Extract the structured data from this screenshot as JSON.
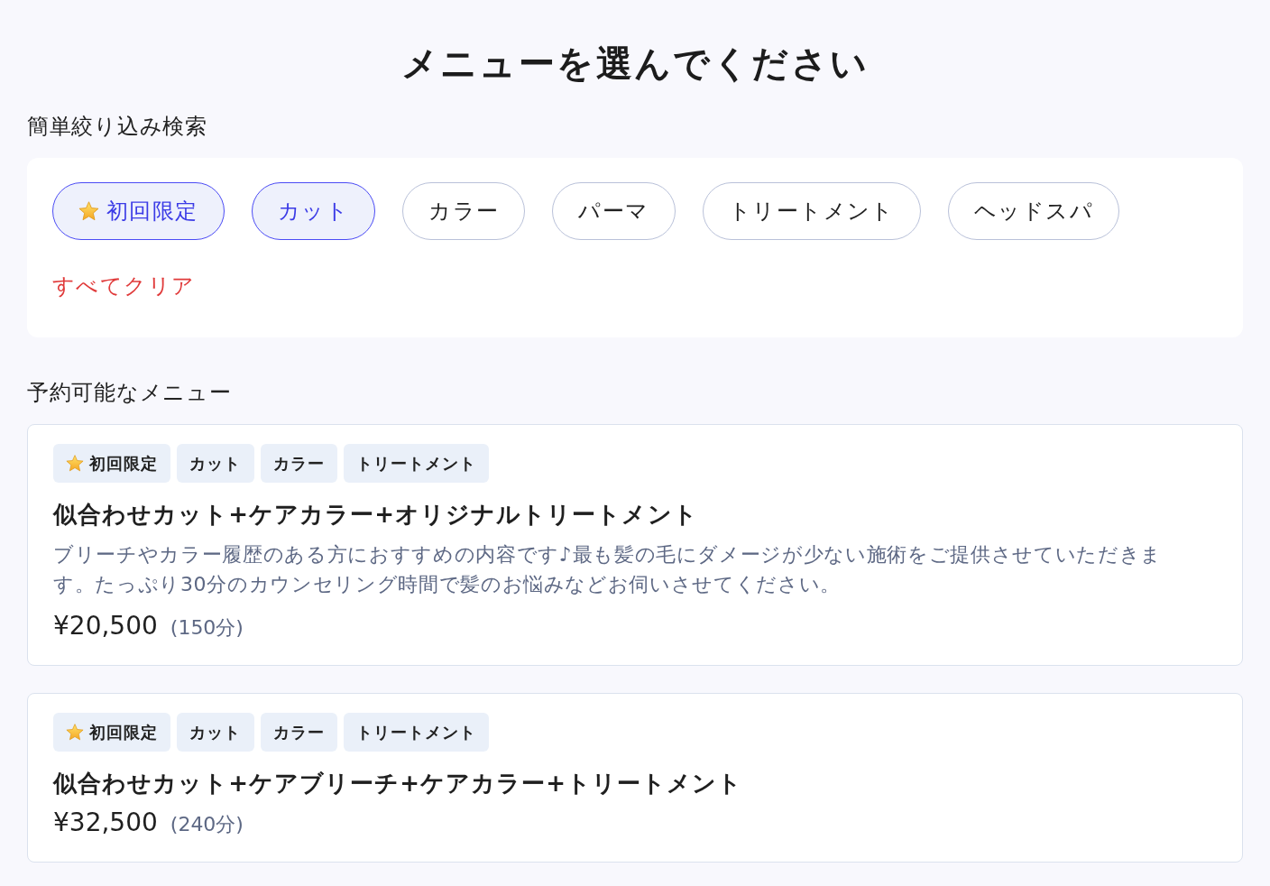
{
  "page": {
    "title": "メニューを選んでください"
  },
  "filter": {
    "heading": "簡単絞り込み検索",
    "chips": [
      {
        "label": "初回限定",
        "kind": "first-time",
        "selected": true
      },
      {
        "label": "カット",
        "kind": "category",
        "selected": true
      },
      {
        "label": "カラー",
        "kind": "category",
        "selected": false
      },
      {
        "label": "パーマ",
        "kind": "category",
        "selected": false
      },
      {
        "label": "トリートメント",
        "kind": "category",
        "selected": false
      },
      {
        "label": "ヘッドスパ",
        "kind": "category",
        "selected": false
      }
    ],
    "clear_link": "すべてクリア"
  },
  "menu": {
    "heading": "予約可能なメニュー",
    "items": [
      {
        "tags": [
          {
            "label": "初回限定",
            "kind": "first-time"
          },
          {
            "label": "カット",
            "kind": "category"
          },
          {
            "label": "カラー",
            "kind": "category"
          },
          {
            "label": "トリートメント",
            "kind": "category"
          }
        ],
        "title": "似合わせカット+ケアカラー+オリジナルトリートメント",
        "description": "ブリーチやカラー履歴のある方におすすめの内容です♪最も髪の毛にダメージが少ない施術をご提供させていただきます。たっぷり30分のカウンセリング時間で髪のお悩みなどお伺いさせてください。",
        "price": "¥20,500",
        "duration": "(150分)"
      },
      {
        "tags": [
          {
            "label": "初回限定",
            "kind": "first-time"
          },
          {
            "label": "カット",
            "kind": "category"
          },
          {
            "label": "カラー",
            "kind": "category"
          },
          {
            "label": "トリートメント",
            "kind": "category"
          }
        ],
        "title": "似合わせカット+ケアブリーチ+ケアカラー+トリートメント",
        "price": "¥32,500",
        "duration": "(240分)"
      }
    ]
  }
}
